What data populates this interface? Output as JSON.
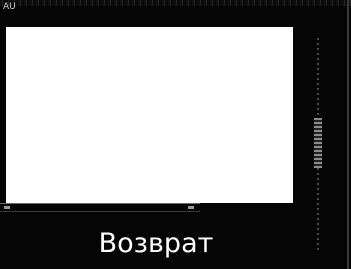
{
  "window": {
    "corner_mark": "AU"
  },
  "main": {
    "back_button_label": "Возврат"
  },
  "colors": {
    "background": "#050505",
    "panel": "#ffffff",
    "text": "#ffffff"
  }
}
